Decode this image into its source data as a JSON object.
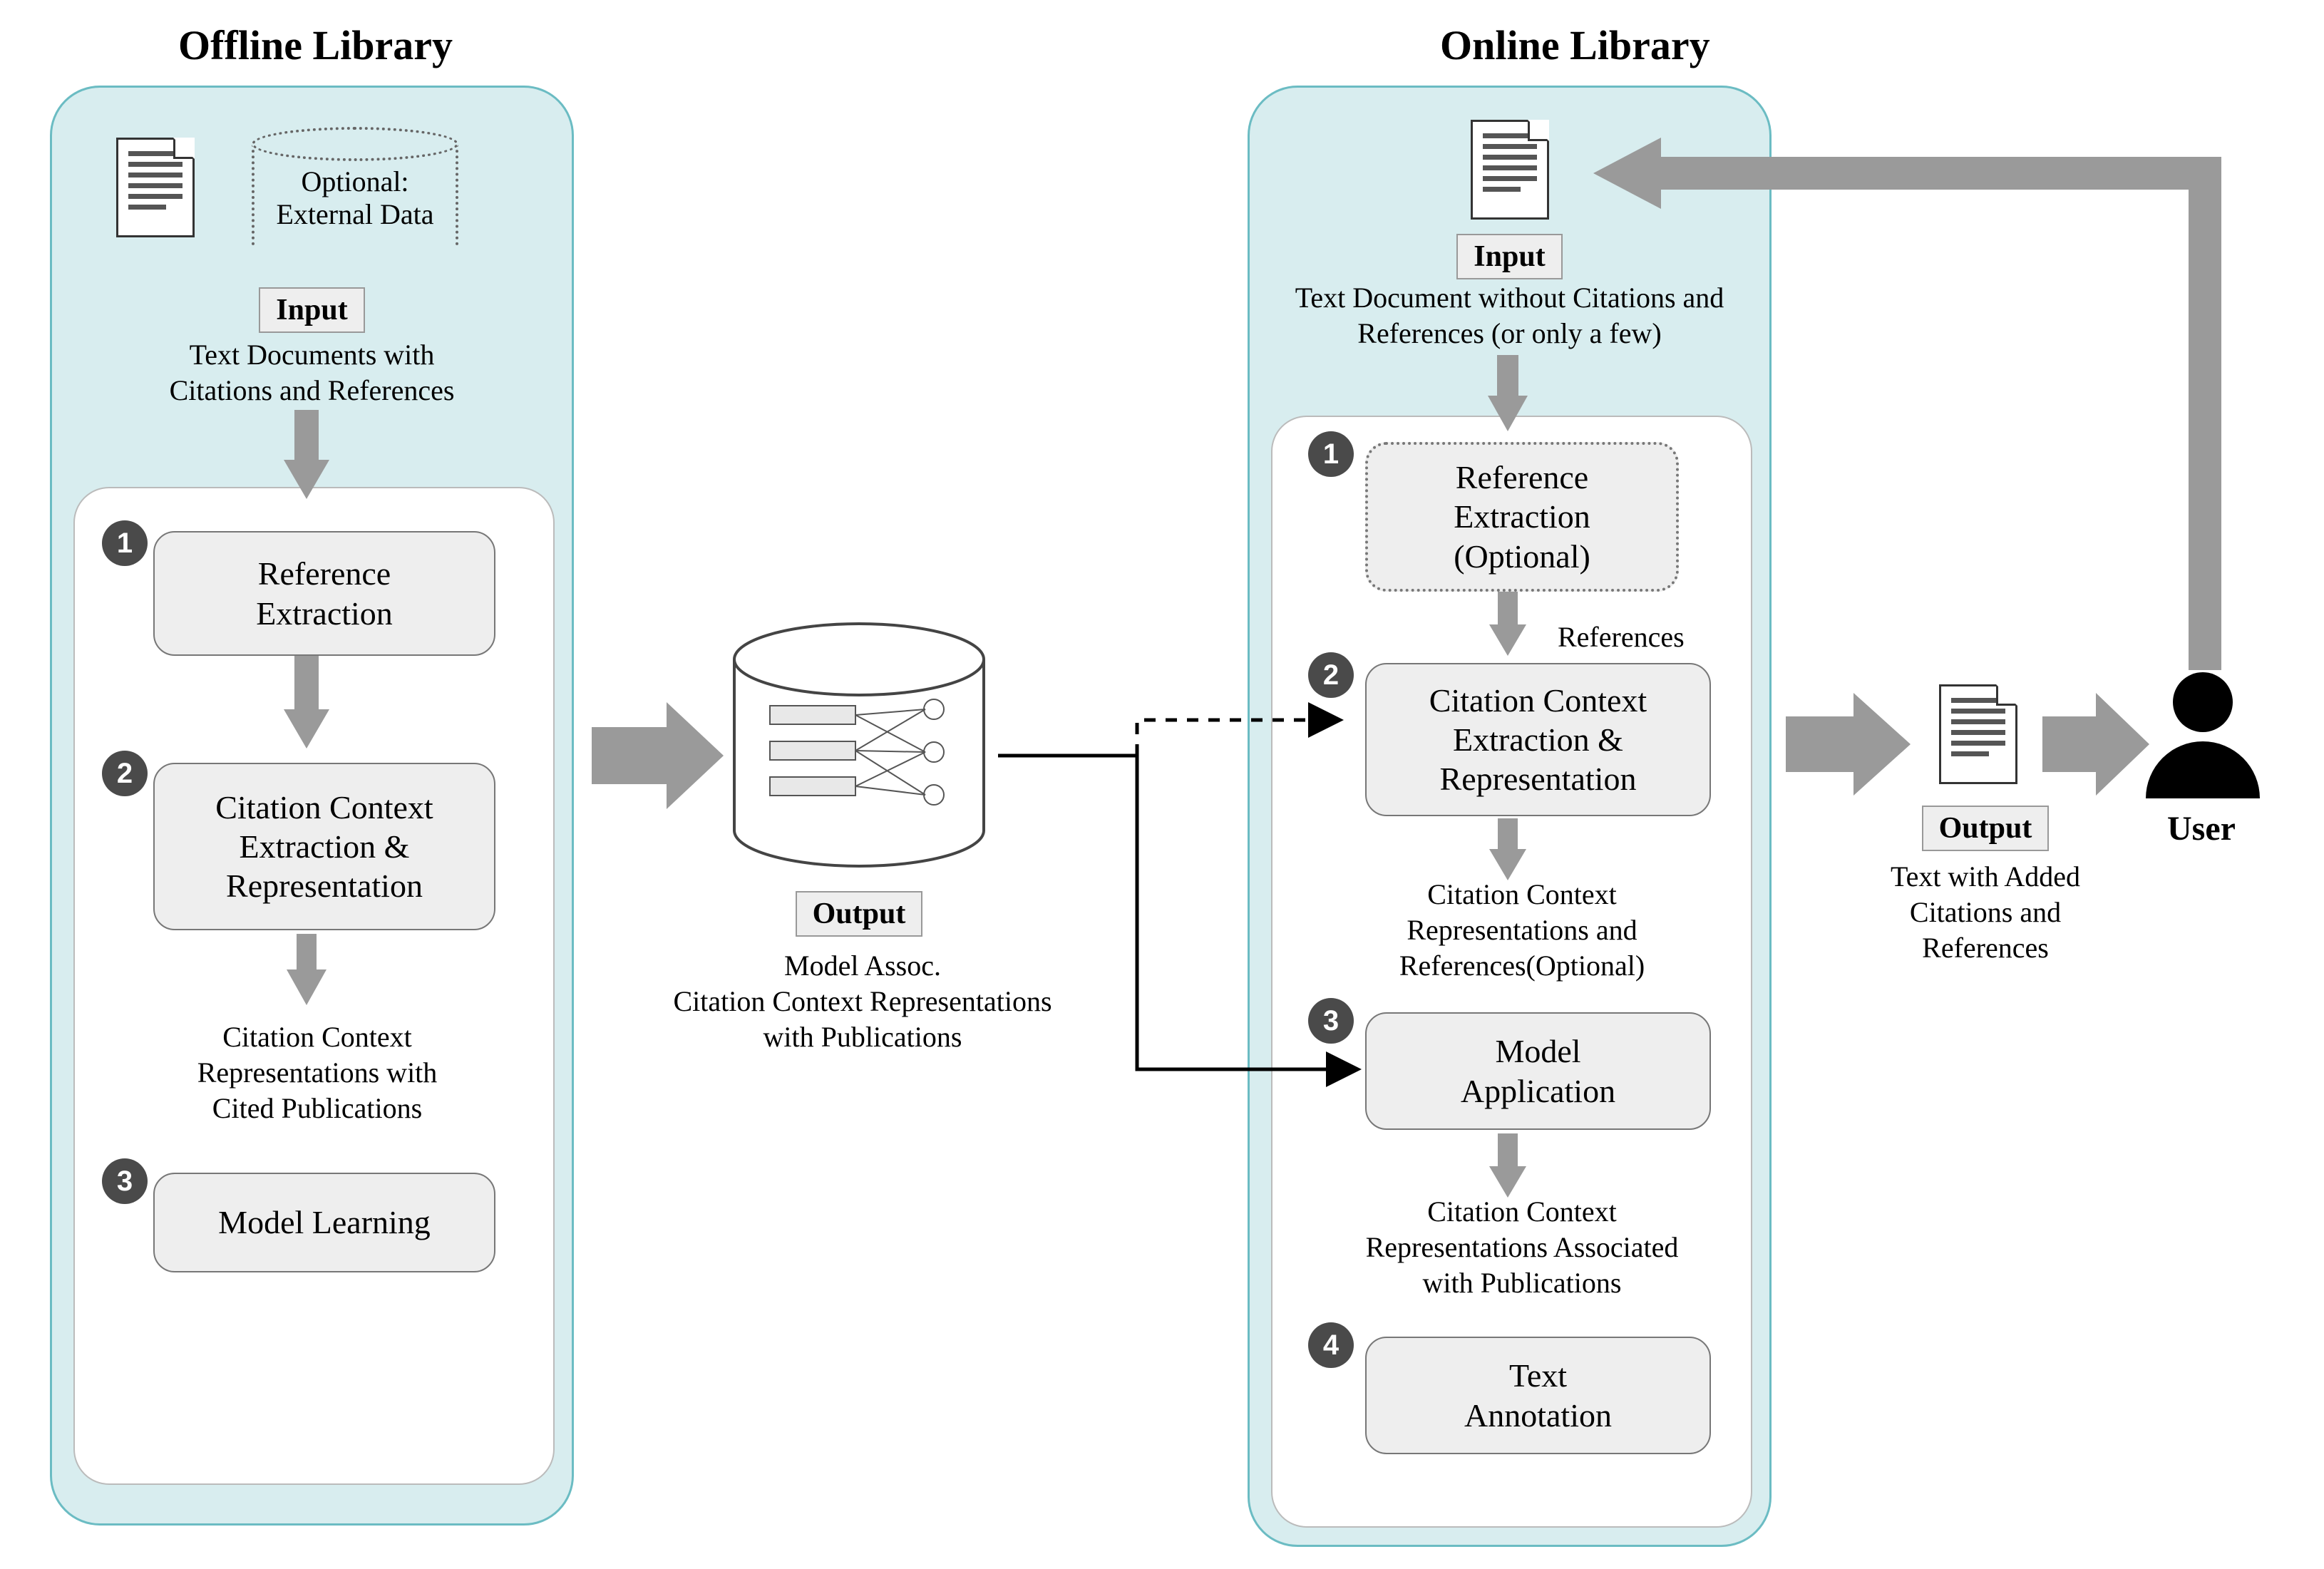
{
  "titles": {
    "offline": "Offline Library",
    "online": "Online Library"
  },
  "offline": {
    "external_data": "Optional:\nExternal Data",
    "input_tag": "Input",
    "input_caption": "Text Documents with\nCitations and References",
    "step1": "Reference\nExtraction",
    "step2": "Citation Context\nExtraction &\nRepresentation",
    "mid_caption": "Citation Context\nRepresentations with\nCited Publications",
    "step3": "Model Learning"
  },
  "db": {
    "output_tag": "Output",
    "caption": "Model Assoc.\nCitation Context Representations\nwith Publications"
  },
  "online": {
    "input_tag": "Input",
    "input_caption": "Text Document without Citations and\nReferences (or only a few)",
    "step1": "Reference\nExtraction\n(Optional)",
    "references_label": "References",
    "step2": "Citation Context\nExtraction &\nRepresentation",
    "mid2": "Citation Context\nRepresentations and\nReferences(Optional)",
    "step3": "Model\nApplication",
    "mid3": "Citation Context\nRepresentations Associated\nwith Publications",
    "step4": "Text\nAnnotation"
  },
  "output": {
    "tag": "Output",
    "caption": "Text with Added\nCitations and\nReferences"
  },
  "user_label": "User",
  "badges": {
    "n1": "1",
    "n2": "2",
    "n3": "3",
    "n4": "4"
  }
}
